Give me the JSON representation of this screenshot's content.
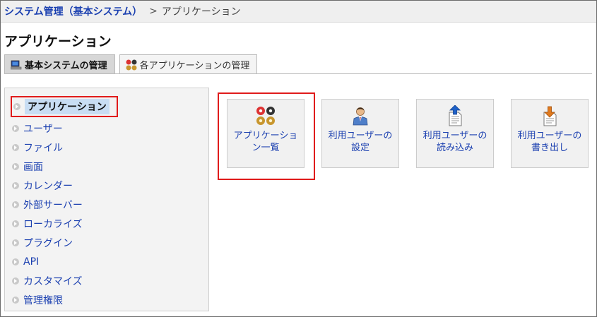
{
  "breadcrumb": {
    "parent": "システム管理（基本システム）",
    "separator": ">",
    "current": "アプリケーション"
  },
  "page_title": "アプリケーション",
  "tabs": [
    {
      "label": "基本システムの管理",
      "icon": "monitor-icon",
      "active": true
    },
    {
      "label": "各アプリケーションの管理",
      "icon": "applications-icon",
      "active": false
    }
  ],
  "sidebar": {
    "items": [
      {
        "label": "アプリケーション",
        "active": true
      },
      {
        "label": "ユーザー"
      },
      {
        "label": "ファイル"
      },
      {
        "label": "画面"
      },
      {
        "label": "カレンダー"
      },
      {
        "label": "外部サーバー"
      },
      {
        "label": "ローカライズ"
      },
      {
        "label": "プラグイン"
      },
      {
        "label": "API"
      },
      {
        "label": "カスタマイズ"
      },
      {
        "label": "管理権限"
      }
    ]
  },
  "cards": [
    {
      "line1": "アプリケーショ",
      "line2": "ン一覧",
      "icon": "applications-icon"
    },
    {
      "line1": "利用ユーザーの",
      "line2": "設定",
      "icon": "user-icon"
    },
    {
      "line1": "利用ユーザーの",
      "line2": "読み込み",
      "icon": "import-icon"
    },
    {
      "line1": "利用ユーザーの",
      "line2": "書き出し",
      "icon": "export-icon"
    }
  ],
  "colors": {
    "link": "#1a3fb0",
    "highlight_border": "#e01b1b",
    "active_menu_bg": "#c8ddf3"
  }
}
